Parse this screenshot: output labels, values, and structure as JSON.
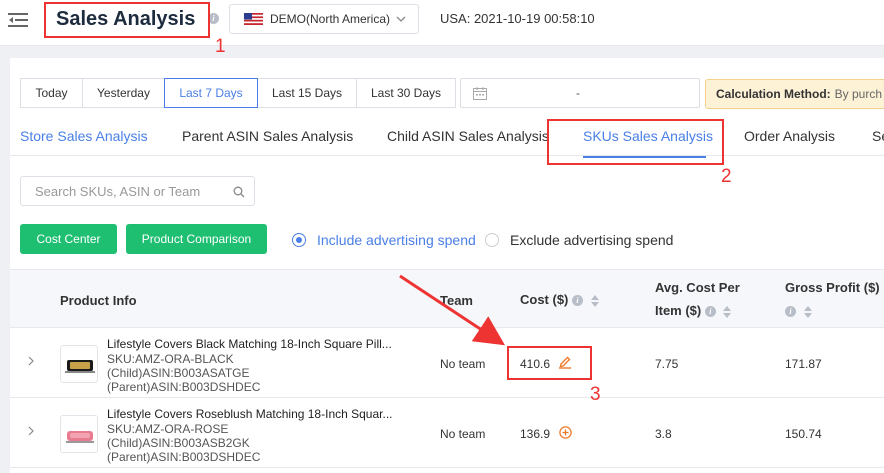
{
  "header": {
    "title": "Sales Analysis",
    "store": "DEMO(North America)",
    "datetime": "USA: 2021-10-19 00:58:10"
  },
  "annotations": {
    "n1": "1",
    "n2": "2",
    "n3": "3"
  },
  "date_range": {
    "tabs": [
      "Today",
      "Yesterday",
      "Last 7 Days",
      "Last 15 Days",
      "Last 30 Days"
    ],
    "active": "Last 7 Days",
    "separator": "-"
  },
  "calculation": {
    "label": "Calculation Method:",
    "value": "By purch"
  },
  "analysis_tabs": [
    "Store Sales Analysis",
    "Parent ASIN Sales Analysis",
    "Child ASIN Sales Analysis",
    "SKUs Sales Analysis",
    "Order Analysis",
    "Se"
  ],
  "search": {
    "placeholder": "Search SKUs, ASIN or Team"
  },
  "buttons": {
    "cost_center": "Cost Center",
    "product_comparison": "Product Comparison"
  },
  "ad_spend": {
    "include": "Include advertising spend",
    "exclude": "Exclude advertising spend",
    "selected": "include"
  },
  "table": {
    "headers": {
      "product_info": "Product Info",
      "team": "Team",
      "cost": "Cost ($)",
      "avg_cost_1": "Avg. Cost Per",
      "avg_cost_2": "Item ($)",
      "gross_profit": "Gross Profit ($)"
    },
    "rows": [
      {
        "name": "Lifestyle Covers Black Matching 18-Inch Square Pill...",
        "sku": "SKU:AMZ-ORA-BLACK",
        "child": "(Child)ASIN:B003ASATGE",
        "parent": "(Parent)ASIN:B003DSHDEC",
        "team": "No team",
        "cost": "410.6",
        "avg_cost": "7.75",
        "gross_profit": "171.87",
        "cost_icon": "edit-icon"
      },
      {
        "name": "Lifestyle Covers Roseblush Matching 18-Inch Squar...",
        "sku": "SKU:AMZ-ORA-ROSE",
        "child": "(Child)ASIN:B003ASB2GK",
        "parent": "(Parent)ASIN:B003DSHDEC",
        "team": "No team",
        "cost": "136.9",
        "avg_cost": "3.8",
        "gross_profit": "150.74",
        "cost_icon": "add-circle-icon"
      }
    ]
  },
  "colors": {
    "accent": "#4a7fe6",
    "button_green": "#1fbf72",
    "annotation_red": "#e33333",
    "edit_orange": "#f07a2c"
  }
}
